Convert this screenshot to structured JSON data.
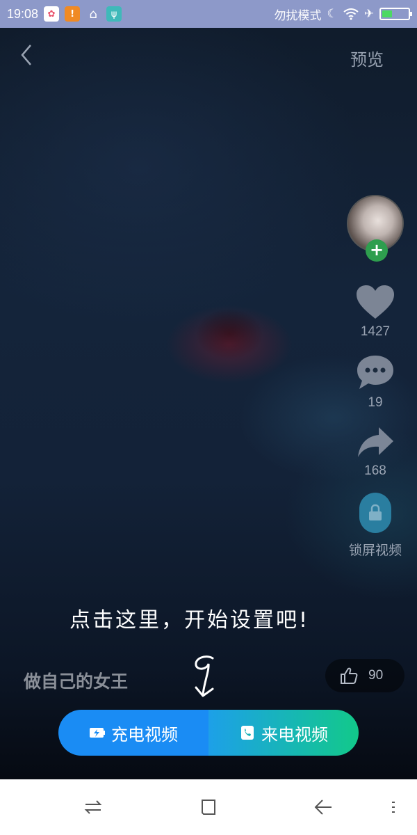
{
  "status_bar": {
    "time": "19:08",
    "dnd_label": "勿扰模式",
    "icons": [
      "photos-icon",
      "warning-icon",
      "clean-icon",
      "usb-icon",
      "moon-icon",
      "wifi-icon",
      "airplane-icon",
      "battery-icon"
    ]
  },
  "header": {
    "back_glyph": "‹",
    "preview_label": "预览"
  },
  "side": {
    "follow_glyph": "+",
    "like_count": "1427",
    "comment_count": "19",
    "share_count": "168",
    "lock_label": "锁屏视频"
  },
  "hint": "点击这里，开始设置吧!",
  "video_title": "做自己的女王",
  "like_pill_count": "90",
  "buttons": {
    "charge_label": "充电视频",
    "call_label": "来电视频"
  },
  "colors": {
    "charge_button": "#1a8cf4",
    "call_button_start": "#1da0e8",
    "call_button_end": "#12c98a",
    "status_bar": "#8d99c9",
    "follow_button": "#2e9e4e"
  }
}
